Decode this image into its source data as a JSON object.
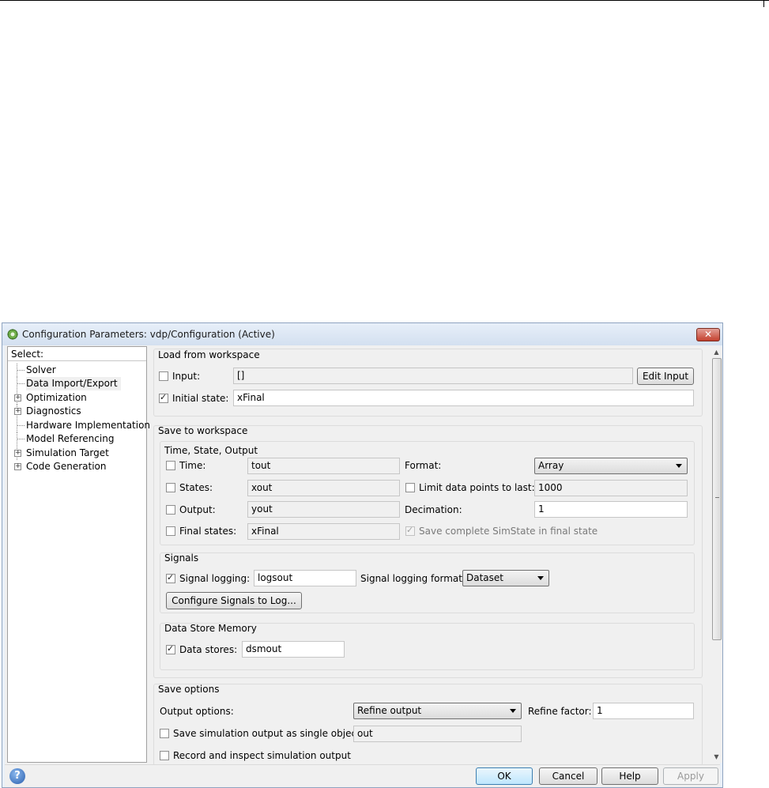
{
  "window": {
    "title": "Configuration Parameters: vdp/Configuration (Active)"
  },
  "tree": {
    "header": "Select:",
    "items": [
      {
        "label": "Solver",
        "expandable": false
      },
      {
        "label": "Data Import/Export",
        "expandable": false,
        "selected": true
      },
      {
        "label": "Optimization",
        "expandable": true
      },
      {
        "label": "Diagnostics",
        "expandable": true
      },
      {
        "label": "Hardware Implementation",
        "expandable": false
      },
      {
        "label": "Model Referencing",
        "expandable": false
      },
      {
        "label": "Simulation Target",
        "expandable": true
      },
      {
        "label": "Code Generation",
        "expandable": true
      }
    ]
  },
  "load": {
    "title": "Load from workspace",
    "input": {
      "label": "Input:",
      "checked": false,
      "value": "[]",
      "button": "Edit Input"
    },
    "initial_state": {
      "label": "Initial state:",
      "checked": true,
      "value": "xFinal"
    }
  },
  "save": {
    "title": "Save to workspace",
    "tso": {
      "title": "Time, State, Output",
      "time": {
        "label": "Time:",
        "checked": false,
        "value": "tout"
      },
      "states": {
        "label": "States:",
        "checked": false,
        "value": "xout"
      },
      "output": {
        "label": "Output:",
        "checked": false,
        "value": "yout"
      },
      "final_states": {
        "label": "Final states:",
        "checked": false,
        "value": "xFinal"
      },
      "format": {
        "label": "Format:",
        "value": "Array"
      },
      "limit": {
        "label": "Limit data points to last:",
        "checked": false,
        "value": "1000"
      },
      "decimation": {
        "label": "Decimation:",
        "value": "1"
      },
      "simstate": {
        "label": "Save complete SimState in final state",
        "checked": true
      }
    },
    "signals": {
      "title": "Signals",
      "logging": {
        "label": "Signal logging:",
        "checked": true,
        "value": "logsout"
      },
      "format_label": "Signal logging format:",
      "format_value": "Dataset",
      "configure_button": "Configure Signals to Log..."
    },
    "dsm": {
      "title": "Data Store Memory",
      "stores": {
        "label": "Data stores:",
        "checked": true,
        "value": "dsmout"
      }
    }
  },
  "options": {
    "title": "Save options",
    "output_options_label": "Output options:",
    "output_options_value": "Refine output",
    "refine_label": "Refine factor:",
    "refine_value": "1",
    "single_object": {
      "label": "Save simulation output as single object",
      "checked": false,
      "value": "out"
    },
    "record": {
      "label": "Record and inspect simulation output",
      "checked": false
    }
  },
  "buttons": {
    "ok": "OK",
    "cancel": "Cancel",
    "help": "Help",
    "apply": "Apply"
  },
  "colors": {
    "titlebar": "#d3e0f0",
    "close": "#c4402e",
    "panel": "#f0f0f0"
  }
}
